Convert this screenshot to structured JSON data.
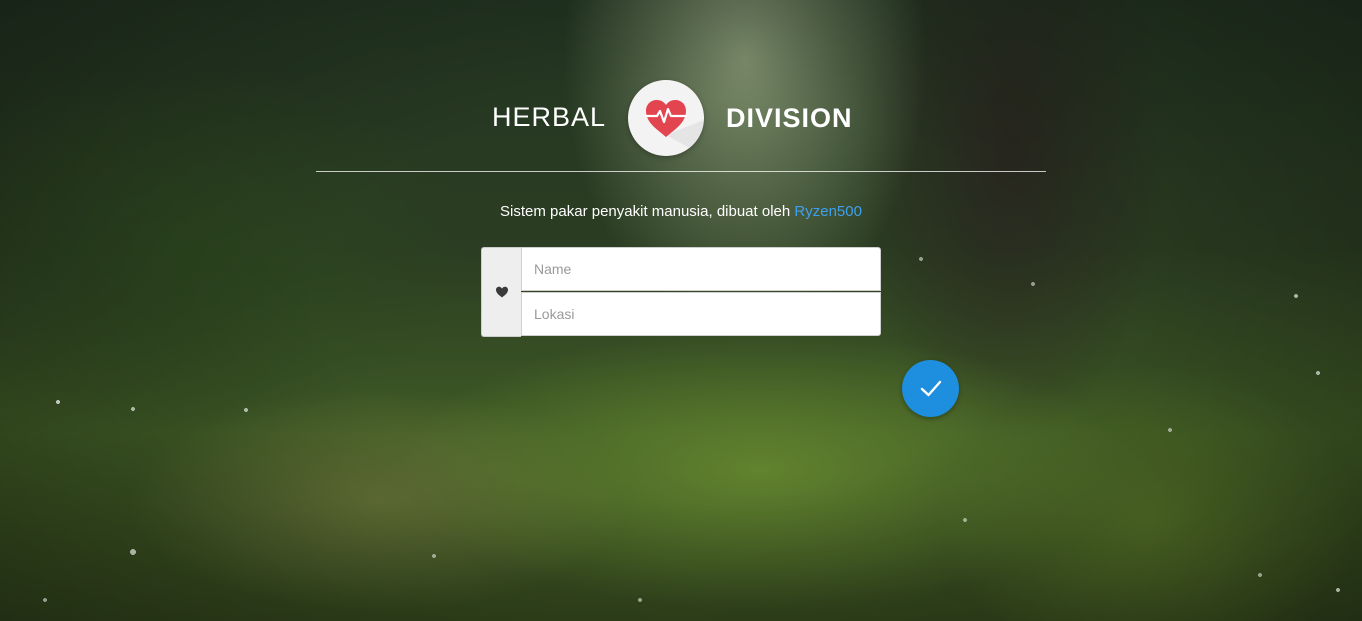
{
  "header": {
    "brand_left": "HERBAL",
    "brand_right": "DIVISION",
    "logo_icon": "heart-pulse-icon"
  },
  "intro": {
    "text": "Sistem pakar penyakit manusia, dibuat oleh ",
    "author_link": "Ryzen500"
  },
  "form": {
    "addon_icon": "heart-icon",
    "name_placeholder": "Name",
    "name_value": "",
    "lokasi_placeholder": "Lokasi",
    "lokasi_value": "",
    "submit_icon": "checkmark-icon"
  },
  "colors": {
    "accent": "#1e8ede",
    "link": "#3ea1ef",
    "logo_heart": "#e2454f"
  }
}
